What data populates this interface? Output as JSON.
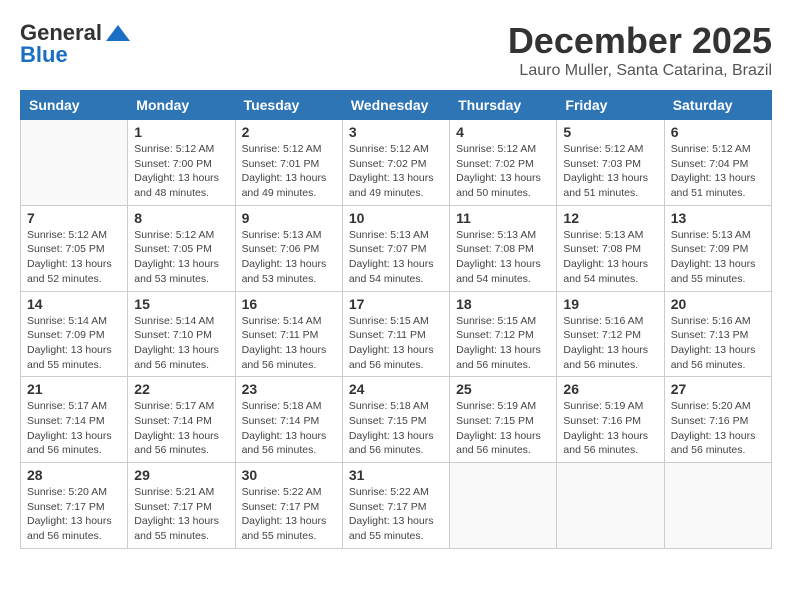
{
  "logo": {
    "general": "General",
    "blue": "Blue"
  },
  "header": {
    "month": "December 2025",
    "location": "Lauro Muller, Santa Catarina, Brazil"
  },
  "weekdays": [
    "Sunday",
    "Monday",
    "Tuesday",
    "Wednesday",
    "Thursday",
    "Friday",
    "Saturday"
  ],
  "weeks": [
    [
      {
        "day": null
      },
      {
        "day": "1",
        "sunrise": "Sunrise: 5:12 AM",
        "sunset": "Sunset: 7:00 PM",
        "daylight": "Daylight: 13 hours and 48 minutes."
      },
      {
        "day": "2",
        "sunrise": "Sunrise: 5:12 AM",
        "sunset": "Sunset: 7:01 PM",
        "daylight": "Daylight: 13 hours and 49 minutes."
      },
      {
        "day": "3",
        "sunrise": "Sunrise: 5:12 AM",
        "sunset": "Sunset: 7:02 PM",
        "daylight": "Daylight: 13 hours and 49 minutes."
      },
      {
        "day": "4",
        "sunrise": "Sunrise: 5:12 AM",
        "sunset": "Sunset: 7:02 PM",
        "daylight": "Daylight: 13 hours and 50 minutes."
      },
      {
        "day": "5",
        "sunrise": "Sunrise: 5:12 AM",
        "sunset": "Sunset: 7:03 PM",
        "daylight": "Daylight: 13 hours and 51 minutes."
      },
      {
        "day": "6",
        "sunrise": "Sunrise: 5:12 AM",
        "sunset": "Sunset: 7:04 PM",
        "daylight": "Daylight: 13 hours and 51 minutes."
      }
    ],
    [
      {
        "day": "7",
        "sunrise": "Sunrise: 5:12 AM",
        "sunset": "Sunset: 7:05 PM",
        "daylight": "Daylight: 13 hours and 52 minutes."
      },
      {
        "day": "8",
        "sunrise": "Sunrise: 5:12 AM",
        "sunset": "Sunset: 7:05 PM",
        "daylight": "Daylight: 13 hours and 53 minutes."
      },
      {
        "day": "9",
        "sunrise": "Sunrise: 5:13 AM",
        "sunset": "Sunset: 7:06 PM",
        "daylight": "Daylight: 13 hours and 53 minutes."
      },
      {
        "day": "10",
        "sunrise": "Sunrise: 5:13 AM",
        "sunset": "Sunset: 7:07 PM",
        "daylight": "Daylight: 13 hours and 54 minutes."
      },
      {
        "day": "11",
        "sunrise": "Sunrise: 5:13 AM",
        "sunset": "Sunset: 7:08 PM",
        "daylight": "Daylight: 13 hours and 54 minutes."
      },
      {
        "day": "12",
        "sunrise": "Sunrise: 5:13 AM",
        "sunset": "Sunset: 7:08 PM",
        "daylight": "Daylight: 13 hours and 54 minutes."
      },
      {
        "day": "13",
        "sunrise": "Sunrise: 5:13 AM",
        "sunset": "Sunset: 7:09 PM",
        "daylight": "Daylight: 13 hours and 55 minutes."
      }
    ],
    [
      {
        "day": "14",
        "sunrise": "Sunrise: 5:14 AM",
        "sunset": "Sunset: 7:09 PM",
        "daylight": "Daylight: 13 hours and 55 minutes."
      },
      {
        "day": "15",
        "sunrise": "Sunrise: 5:14 AM",
        "sunset": "Sunset: 7:10 PM",
        "daylight": "Daylight: 13 hours and 56 minutes."
      },
      {
        "day": "16",
        "sunrise": "Sunrise: 5:14 AM",
        "sunset": "Sunset: 7:11 PM",
        "daylight": "Daylight: 13 hours and 56 minutes."
      },
      {
        "day": "17",
        "sunrise": "Sunrise: 5:15 AM",
        "sunset": "Sunset: 7:11 PM",
        "daylight": "Daylight: 13 hours and 56 minutes."
      },
      {
        "day": "18",
        "sunrise": "Sunrise: 5:15 AM",
        "sunset": "Sunset: 7:12 PM",
        "daylight": "Daylight: 13 hours and 56 minutes."
      },
      {
        "day": "19",
        "sunrise": "Sunrise: 5:16 AM",
        "sunset": "Sunset: 7:12 PM",
        "daylight": "Daylight: 13 hours and 56 minutes."
      },
      {
        "day": "20",
        "sunrise": "Sunrise: 5:16 AM",
        "sunset": "Sunset: 7:13 PM",
        "daylight": "Daylight: 13 hours and 56 minutes."
      }
    ],
    [
      {
        "day": "21",
        "sunrise": "Sunrise: 5:17 AM",
        "sunset": "Sunset: 7:14 PM",
        "daylight": "Daylight: 13 hours and 56 minutes."
      },
      {
        "day": "22",
        "sunrise": "Sunrise: 5:17 AM",
        "sunset": "Sunset: 7:14 PM",
        "daylight": "Daylight: 13 hours and 56 minutes."
      },
      {
        "day": "23",
        "sunrise": "Sunrise: 5:18 AM",
        "sunset": "Sunset: 7:14 PM",
        "daylight": "Daylight: 13 hours and 56 minutes."
      },
      {
        "day": "24",
        "sunrise": "Sunrise: 5:18 AM",
        "sunset": "Sunset: 7:15 PM",
        "daylight": "Daylight: 13 hours and 56 minutes."
      },
      {
        "day": "25",
        "sunrise": "Sunrise: 5:19 AM",
        "sunset": "Sunset: 7:15 PM",
        "daylight": "Daylight: 13 hours and 56 minutes."
      },
      {
        "day": "26",
        "sunrise": "Sunrise: 5:19 AM",
        "sunset": "Sunset: 7:16 PM",
        "daylight": "Daylight: 13 hours and 56 minutes."
      },
      {
        "day": "27",
        "sunrise": "Sunrise: 5:20 AM",
        "sunset": "Sunset: 7:16 PM",
        "daylight": "Daylight: 13 hours and 56 minutes."
      }
    ],
    [
      {
        "day": "28",
        "sunrise": "Sunrise: 5:20 AM",
        "sunset": "Sunset: 7:17 PM",
        "daylight": "Daylight: 13 hours and 56 minutes."
      },
      {
        "day": "29",
        "sunrise": "Sunrise: 5:21 AM",
        "sunset": "Sunset: 7:17 PM",
        "daylight": "Daylight: 13 hours and 55 minutes."
      },
      {
        "day": "30",
        "sunrise": "Sunrise: 5:22 AM",
        "sunset": "Sunset: 7:17 PM",
        "daylight": "Daylight: 13 hours and 55 minutes."
      },
      {
        "day": "31",
        "sunrise": "Sunrise: 5:22 AM",
        "sunset": "Sunset: 7:17 PM",
        "daylight": "Daylight: 13 hours and 55 minutes."
      },
      {
        "day": null
      },
      {
        "day": null
      },
      {
        "day": null
      }
    ]
  ]
}
